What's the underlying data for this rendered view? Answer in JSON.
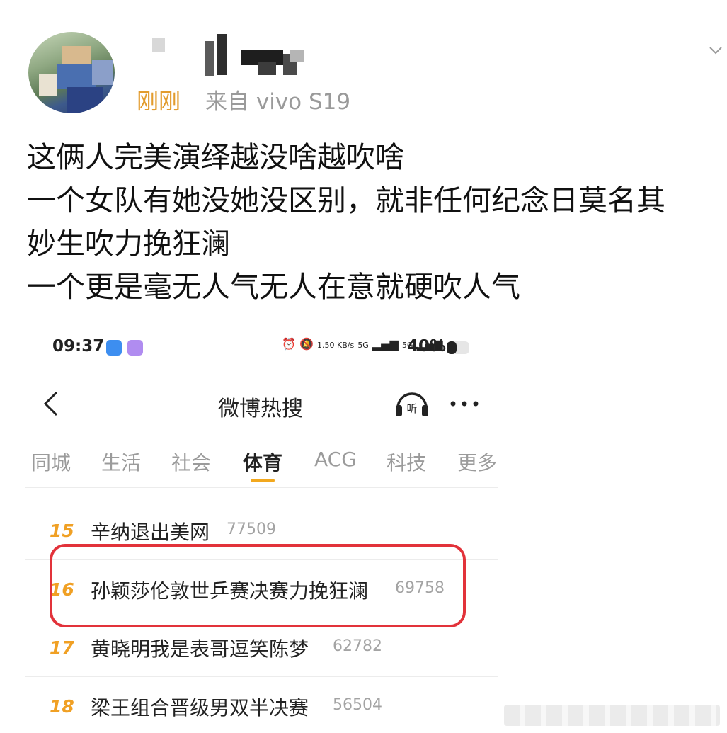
{
  "post": {
    "time": "刚刚",
    "source": "来自 vivo S19",
    "lines": [
      "这俩人完美演绎越没啥越吹啥",
      "一个女队有她没她没区别，就非任何纪念日莫名其",
      "妙生吹力挽狂澜",
      "一个更是毫无人气无人在意就硬吹人气"
    ]
  },
  "screenshot": {
    "status_bar": {
      "time": "09:37",
      "net_speed": "1.50 KB/s",
      "signal_1": "5G",
      "signal_2": "5G",
      "battery": "40%"
    },
    "title": "微博热搜",
    "tabs": [
      "同城",
      "生活",
      "社会",
      "体育",
      "ACG",
      "科技",
      "更多"
    ],
    "active_tab": "体育",
    "hot_list": [
      {
        "rank": "15",
        "topic": "辛纳退出美网",
        "heat": "77509"
      },
      {
        "rank": "16",
        "topic": "孙颖莎伦敦世乒赛决赛力挽狂澜",
        "heat": "69758"
      },
      {
        "rank": "17",
        "topic": "黄晓明我是表哥逗笑陈梦",
        "heat": "62782"
      },
      {
        "rank": "18",
        "topic": "梁王组合晋级男双半决赛",
        "heat": "56504"
      }
    ]
  },
  "colors": {
    "time_accent": "#e29c2e",
    "rank_accent": "#f0a024",
    "tab_underline": "#f2a81e",
    "highlight_border": "#e2323a"
  }
}
